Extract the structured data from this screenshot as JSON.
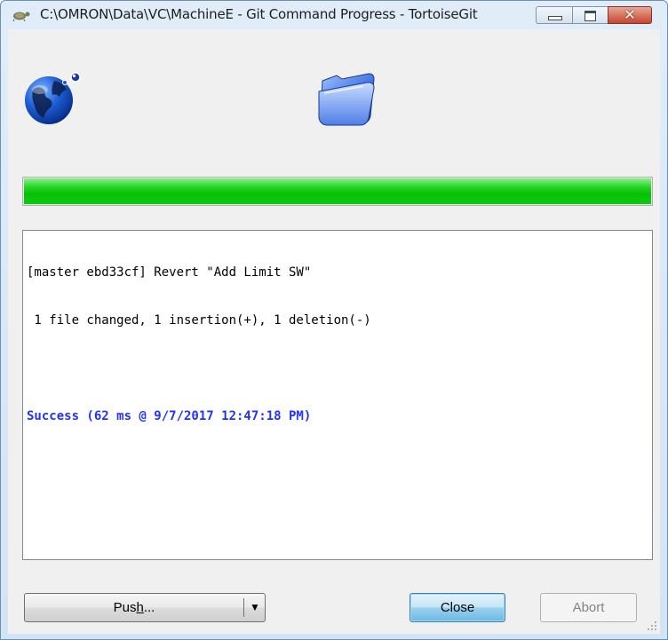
{
  "window": {
    "title": "C:\\OMRON\\Data\\VC\\MachineE - Git Command Progress - TortoiseGit",
    "caption_buttons": {
      "close_glyph": "✕"
    }
  },
  "icons": {
    "app": "tortoisegit-app-icon",
    "source": "globe-icon",
    "target": "folder-icon"
  },
  "progress": {
    "fraction": 1.0,
    "color": "#0cc40c"
  },
  "log": {
    "lines": [
      "[master ebd33cf] Revert \"Add Limit SW\"",
      " 1 file changed, 1 insertion(+), 1 deletion(-)"
    ],
    "success": "Success (62 ms @ 9/7/2017 12:47:18 PM)",
    "success_color": "#2233ff"
  },
  "buttons": {
    "push_label": "Push...",
    "push_dropdown": "▼",
    "close_label": "Close",
    "abort_label": "Abort"
  }
}
